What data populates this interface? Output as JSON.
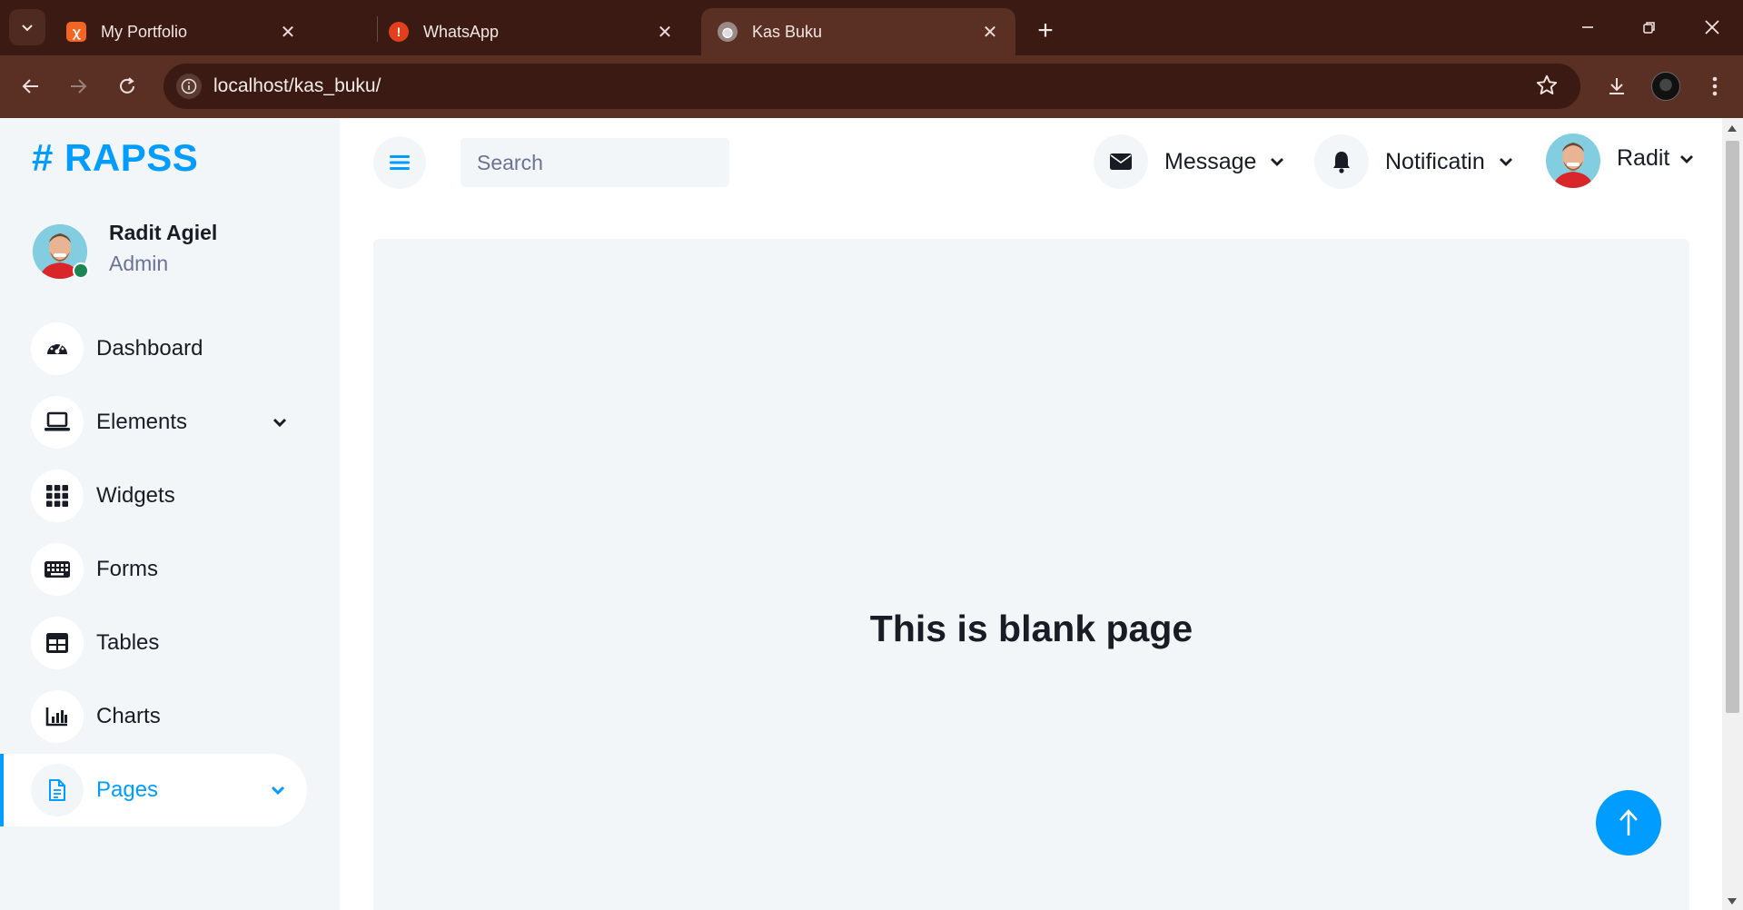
{
  "browser": {
    "tabs": [
      {
        "title": "My Portfolio",
        "favicon_color": "#f26522"
      },
      {
        "title": "WhatsApp",
        "favicon_color": "#e2401c"
      },
      {
        "title": "Kas Buku",
        "favicon_color": "#9a8a86",
        "active": true
      }
    ],
    "url": "localhost/kas_buku/"
  },
  "brand": "# RAPSS",
  "user": {
    "name": "Radit Agiel",
    "role": "Admin"
  },
  "sidebar": {
    "items": [
      {
        "label": "Dashboard",
        "icon": "speedometer-icon"
      },
      {
        "label": "Elements",
        "icon": "laptop-icon",
        "has_dropdown": true
      },
      {
        "label": "Widgets",
        "icon": "grid-icon"
      },
      {
        "label": "Forms",
        "icon": "keyboard-icon"
      },
      {
        "label": "Tables",
        "icon": "table-icon"
      },
      {
        "label": "Charts",
        "icon": "bar-chart-icon"
      },
      {
        "label": "Pages",
        "icon": "file-icon",
        "has_dropdown": true,
        "active": true
      }
    ]
  },
  "topbar": {
    "search_placeholder": "Search",
    "message_label": "Message",
    "notification_label": "Notificatin",
    "profile_label": "Radit"
  },
  "content": {
    "title": "This is blank page"
  },
  "colors": {
    "accent": "#009cff",
    "chrome_dark": "#3a1a12",
    "chrome_mid": "#5a2f24",
    "page_bg": "#f3f6f9"
  }
}
